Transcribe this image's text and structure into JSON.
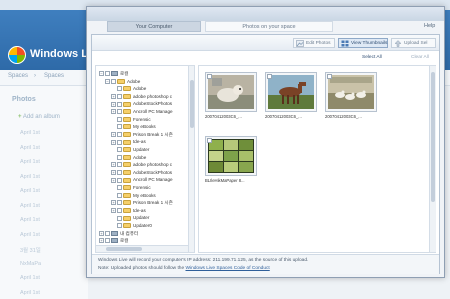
{
  "background": {
    "brand": "Windows Li",
    "breadcrumb": [
      "Spaces",
      "Spaces"
    ],
    "sidebar_title": "Photos",
    "add_album": "Add an album",
    "sidebar_items": [
      "April 1st",
      "April 1st",
      "April 1st",
      "April 1st",
      "April 1st",
      "April 1st",
      "April 1st",
      "April 1st",
      "3월 31일",
      "NxMaPa",
      "April 1st",
      "April 1st"
    ]
  },
  "dialog": {
    "tabs": [
      "Your Computer",
      "Photos on your space"
    ],
    "help": "Help",
    "toolbar": {
      "edit": "Edit Photos",
      "view": "View Thumbnails",
      "upload": "Upload Sel"
    },
    "select_all": "Select All",
    "clear_all": "Clear All",
    "tree": [
      {
        "label": "로컬",
        "level": 0,
        "kind": "drive",
        "toggle": "-"
      },
      {
        "label": "Adobe",
        "level": 1,
        "kind": "folder",
        "toggle": "-"
      },
      {
        "label": "Adobe",
        "level": 2,
        "kind": "folder",
        "toggle": ""
      },
      {
        "label": "adobe photoshop c",
        "level": 2,
        "kind": "folder",
        "toggle": "+"
      },
      {
        "label": "AdobeStockPhotos",
        "level": 2,
        "kind": "folder",
        "toggle": "+"
      },
      {
        "label": "Ancroll PC Manage",
        "level": 2,
        "kind": "folder",
        "toggle": "+"
      },
      {
        "label": "Forensic",
        "level": 2,
        "kind": "folder",
        "toggle": ""
      },
      {
        "label": "My eBooks",
        "level": 2,
        "kind": "folder",
        "toggle": ""
      },
      {
        "label": "Prison Break 1 시즌",
        "level": 2,
        "kind": "folder",
        "toggle": "+"
      },
      {
        "label": "tde-as",
        "level": 2,
        "kind": "folder",
        "toggle": "+"
      },
      {
        "label": "Updater",
        "level": 2,
        "kind": "folder",
        "toggle": ""
      },
      {
        "label": "Adobe",
        "level": 2,
        "kind": "folder",
        "toggle": ""
      },
      {
        "label": "adobe photoshop c",
        "level": 2,
        "kind": "folder",
        "toggle": "+"
      },
      {
        "label": "AdobeStockPhotos",
        "level": 2,
        "kind": "folder",
        "toggle": "+"
      },
      {
        "label": "Ancroll PC Manage",
        "level": 2,
        "kind": "folder",
        "toggle": "+"
      },
      {
        "label": "Forensic",
        "level": 2,
        "kind": "folder",
        "toggle": ""
      },
      {
        "label": "My eBooks",
        "level": 2,
        "kind": "folder",
        "toggle": ""
      },
      {
        "label": "Prison Break 1 시즌",
        "level": 2,
        "kind": "folder",
        "toggle": "+"
      },
      {
        "label": "tde-as",
        "level": 2,
        "kind": "folder",
        "toggle": "+"
      },
      {
        "label": "Updater",
        "level": 2,
        "kind": "folder",
        "toggle": ""
      },
      {
        "label": "Updater0",
        "level": 2,
        "kind": "folder",
        "toggle": ""
      },
      {
        "label": "내 컴퓨터",
        "level": 0,
        "kind": "drive",
        "toggle": "+"
      },
      {
        "label": "로컬",
        "level": 0,
        "kind": "drive",
        "toggle": "+"
      }
    ],
    "photos": [
      {
        "caption": "20070412003C6_...",
        "scene": "dog"
      },
      {
        "caption": "20070412003C6_...",
        "scene": "horse"
      },
      {
        "caption": "20070412003C6_...",
        "scene": "ducks"
      },
      {
        "caption": "BLIleHikMaPaper 8...",
        "scene": "grid"
      }
    ],
    "footer_line1": "Windows Live will record your computer's IP address: 211.199.71.125, as the source of this upload.",
    "footer_line2_prefix": "Note: Uploaded photos should follow the",
    "footer_link": "Windows Live Spaces Code of Conduct"
  }
}
